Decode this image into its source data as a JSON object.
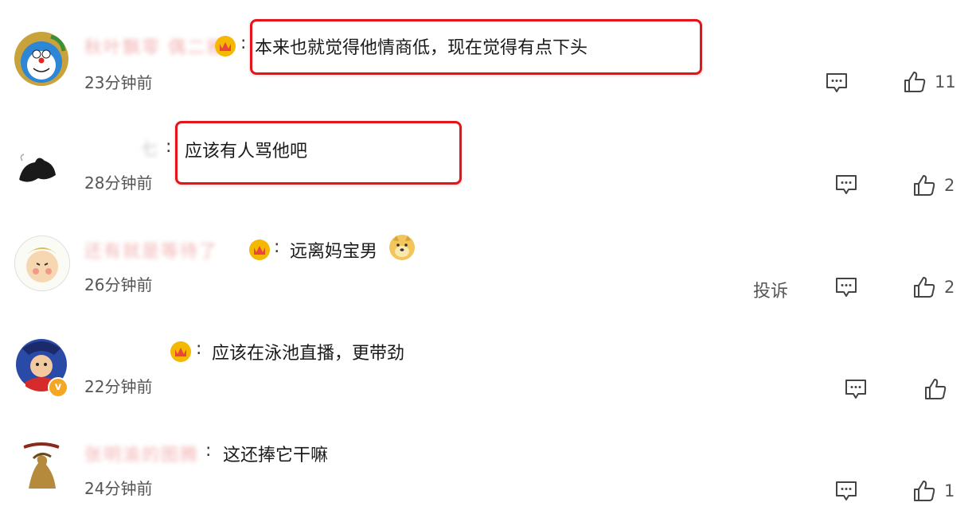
{
  "comments": [
    {
      "name": "秋叶飘零 偶二雅",
      "colon": ":",
      "text": "本来也就觉得他情商低，现在觉得有点下头",
      "time": "23分钟前",
      "likes": "11"
    },
    {
      "name": "七",
      "colon": ":",
      "text": "应该有人骂他吧",
      "time": "28分钟前",
      "likes": "2"
    },
    {
      "name": "还有就是等待了",
      "colon": ":",
      "text": "远离妈宝男",
      "time": "26分钟前",
      "report": "投诉",
      "likes": "2"
    },
    {
      "name": "",
      "colon": ":",
      "text": "应该在泳池直播，更带劲",
      "time": "22分钟前",
      "likes": ""
    },
    {
      "name": "张明渝的图腾",
      "colon": ":",
      "text": "这还捧它干嘛",
      "time": "24分钟前",
      "likes": "1"
    }
  ],
  "icons": {
    "comment": "comment-bubble-icon",
    "like": "thumbs-up-icon",
    "badge": "crown-badge-icon",
    "verified": "verified-icon",
    "emoji": "doge-emoji-icon"
  },
  "colors": {
    "highlight": "#e5141a",
    "text": "#1a1a1a",
    "meta": "#555555",
    "badge_red": "#e8453c",
    "badge_gold": "#f5b800"
  }
}
